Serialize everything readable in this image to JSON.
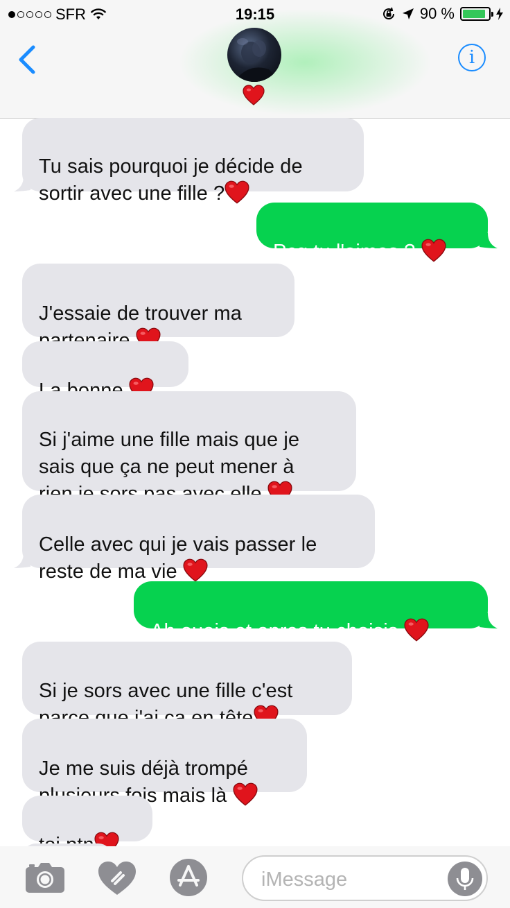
{
  "status_bar": {
    "carrier": "SFR",
    "time": "19:15",
    "battery_percent": "90 %",
    "battery_level": 0.9,
    "signal_strength": 1
  },
  "header": {
    "contact_emoji": "❤️"
  },
  "messages": [
    {
      "id": "m1",
      "direction": "received",
      "text": "Tu sais pourquoi je décide de\nsortir avec une fille ?",
      "emoji": "❤️"
    },
    {
      "id": "m2",
      "direction": "sent",
      "text": "Pcq tu l'aimes ?",
      "emoji": "❤️"
    },
    {
      "id": "m3",
      "direction": "received",
      "text": "J'essaie de trouver ma\npartenaire",
      "emoji": "❤️"
    },
    {
      "id": "m4",
      "direction": "received",
      "text": "La bonne",
      "emoji": "❤️"
    },
    {
      "id": "m5",
      "direction": "received",
      "text": "Si j'aime une fille mais que je\nsais que ça ne peut mener à\nrien je sors pas avec elle",
      "emoji": "❤️"
    },
    {
      "id": "m6",
      "direction": "received",
      "text": "Celle avec qui je vais passer le\nreste de ma vie",
      "emoji": "❤️"
    },
    {
      "id": "m7",
      "direction": "sent",
      "text": "Ah ouais et apres tu choisis",
      "emoji": "❤️"
    },
    {
      "id": "m8",
      "direction": "received",
      "text": "Si je sors avec une fille c'est\nparce que j'ai ça en tête",
      "emoji": "❤️"
    },
    {
      "id": "m9",
      "direction": "received",
      "text": "Je me suis déjà trompé\nplusieurs fois mais là",
      "emoji": "❤️"
    },
    {
      "id": "m10",
      "direction": "received",
      "text": "toi ptn",
      "emoji": "❤️"
    }
  ],
  "input": {
    "placeholder": "iMessage"
  },
  "colors": {
    "sent_bubble": "#06d24f",
    "received_bubble": "#e5e5ea",
    "ios_blue": "#1a8cff",
    "heart_red": "#e0141c"
  },
  "icons": [
    "back-chevron-icon",
    "info-icon",
    "camera-icon",
    "digital-touch-icon",
    "app-store-icon",
    "microphone-icon",
    "wifi-icon",
    "location-arrow-icon",
    "rotation-lock-icon",
    "charging-bolt-icon"
  ]
}
